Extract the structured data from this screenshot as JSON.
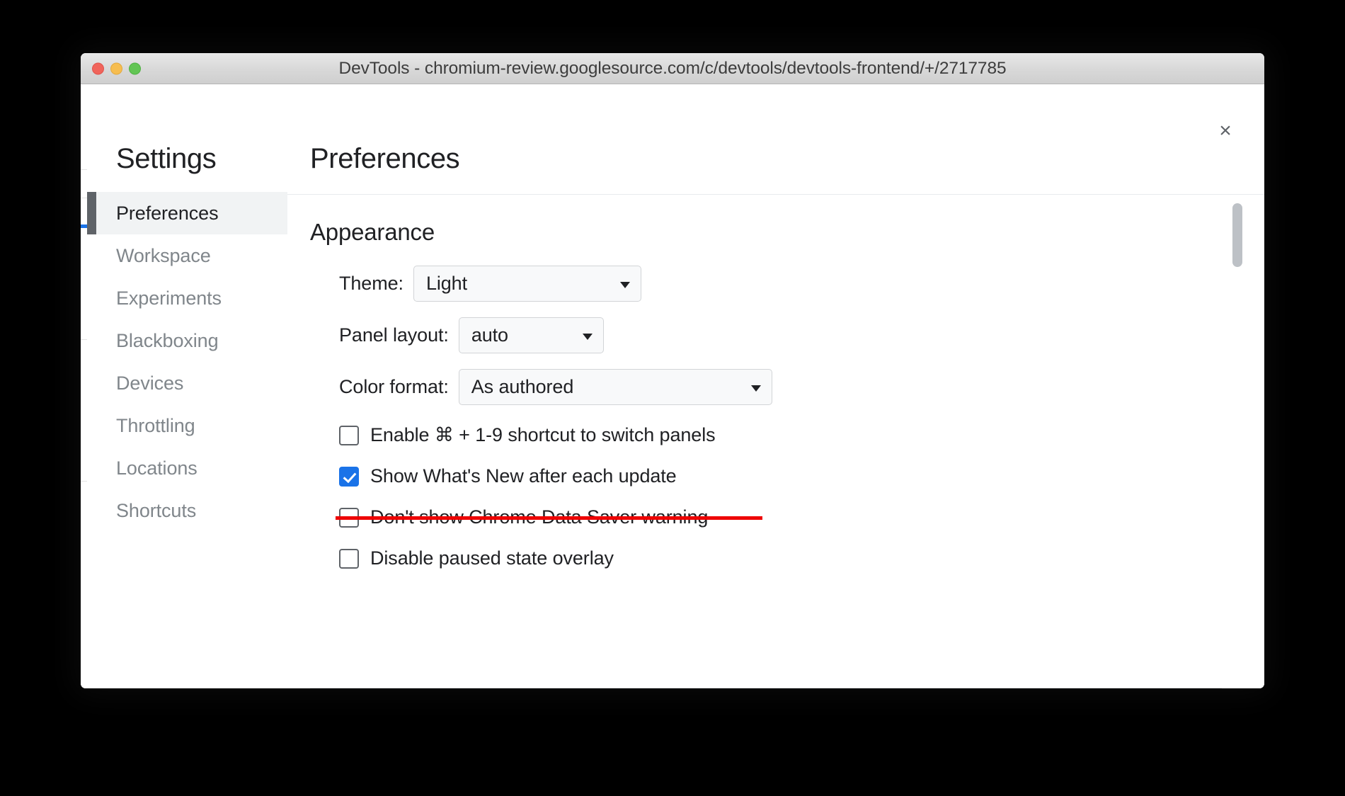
{
  "window": {
    "title": "DevTools - chromium-review.googlesource.com/c/devtools/devtools-frontend/+/2717785",
    "traffic_lights": [
      "close",
      "minimize",
      "zoom"
    ]
  },
  "dialog": {
    "close_label": "×",
    "sidebar": {
      "title": "Settings",
      "items": [
        {
          "label": "Preferences",
          "selected": true
        },
        {
          "label": "Workspace",
          "selected": false
        },
        {
          "label": "Experiments",
          "selected": false
        },
        {
          "label": "Blackboxing",
          "selected": false
        },
        {
          "label": "Devices",
          "selected": false
        },
        {
          "label": "Throttling",
          "selected": false
        },
        {
          "label": "Locations",
          "selected": false
        },
        {
          "label": "Shortcuts",
          "selected": false
        }
      ]
    },
    "content": {
      "title": "Preferences",
      "section_heading": "Appearance",
      "selects": [
        {
          "label": "Theme:",
          "value": "Light"
        },
        {
          "label": "Panel layout:",
          "value": "auto"
        },
        {
          "label": "Color format:",
          "value": "As authored"
        }
      ],
      "checkboxes": [
        {
          "label": "Enable ⌘ + 1-9 shortcut to switch panels",
          "checked": false,
          "struck": false
        },
        {
          "label": "Show What's New after each update",
          "checked": true,
          "struck": false
        },
        {
          "label": "Don't show Chrome Data Saver warning",
          "checked": false,
          "struck": true
        },
        {
          "label": "Disable paused state overlay",
          "checked": false,
          "struck": false
        }
      ]
    }
  },
  "colors": {
    "accent": "#1a73e8",
    "annotation": "#ee0000",
    "selected_bg": "#f1f3f4",
    "selected_bar": "#5f6368",
    "text_primary": "#202124",
    "text_muted": "#80868b"
  }
}
